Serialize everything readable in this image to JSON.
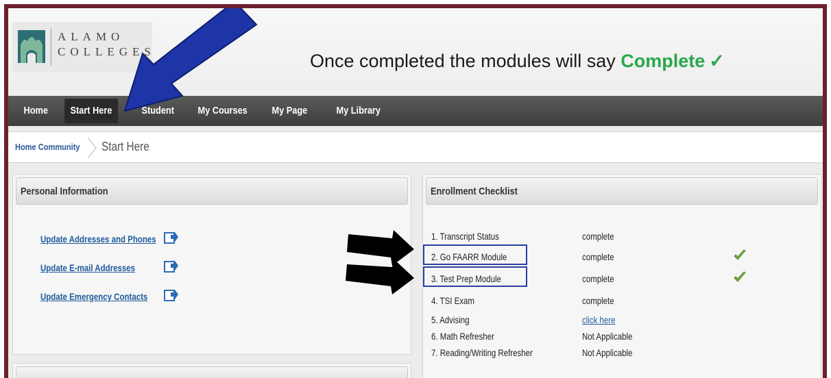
{
  "logo": {
    "line1": "ALAMO",
    "line2": "COLLEGES"
  },
  "banner": {
    "prefix": "Once completed the modules will say ",
    "highlight": "Complete",
    "check": "✓"
  },
  "nav": {
    "items": [
      "Home",
      "Start Here",
      "Student",
      "My Courses",
      "My Page",
      "My Library"
    ],
    "active": "Start Here"
  },
  "breadcrumb": {
    "home": "Home Community",
    "current": "Start Here"
  },
  "personal_info": {
    "title": "Personal Information",
    "links": [
      "Update Addresses and Phones",
      "Update E-mail Addresses",
      "Update Emergency Contacts"
    ]
  },
  "checklist": {
    "title": "Enrollment Checklist",
    "items": [
      {
        "label": "1. Transcript Status",
        "status": "complete",
        "checked": false
      },
      {
        "label": "2. Go FAARR Module",
        "status": "complete",
        "checked": true
      },
      {
        "label": "3. Test Prep Module",
        "status": "complete",
        "checked": true
      },
      {
        "label": "4. TSI Exam",
        "status": "complete",
        "checked": false
      },
      {
        "label": "5. Advising",
        "status": "click here",
        "checked": false
      },
      {
        "label": "6. Math Refresher",
        "status": "Not Applicable",
        "checked": false
      },
      {
        "label": "7. Reading/Writing Refresher",
        "status": "Not Applicable",
        "checked": false
      }
    ]
  },
  "colors": {
    "accent_green": "#2aa84a",
    "nav_bg": "#4a4a4a",
    "link_blue": "#1f5b9c",
    "frame": "#6e1f2e",
    "highlight_box": "#2a3fa0"
  }
}
